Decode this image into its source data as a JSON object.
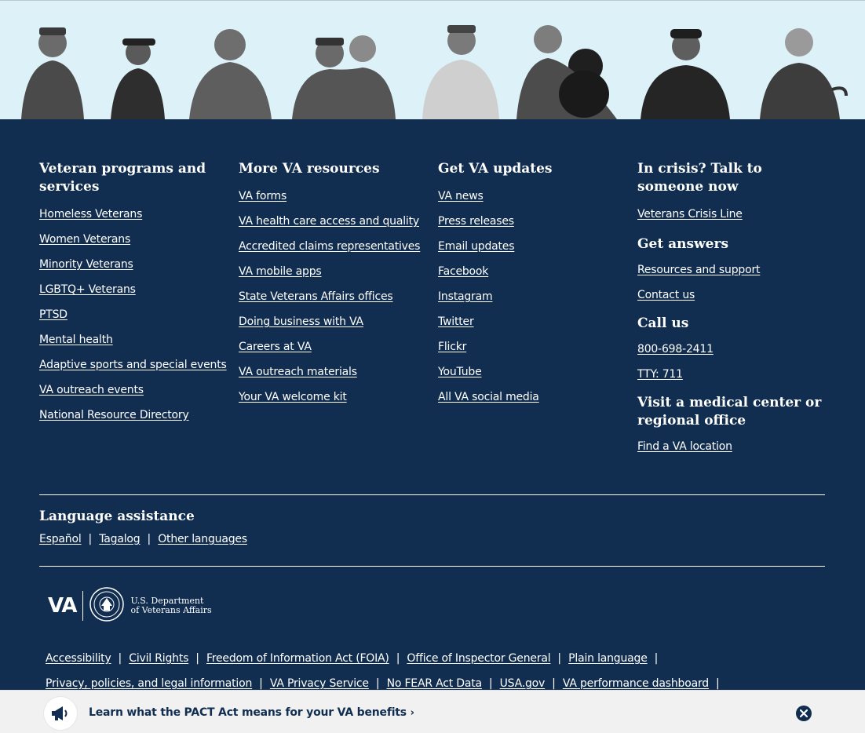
{
  "columns": [
    {
      "heading": "Veteran programs and services",
      "links": [
        "Homeless Veterans",
        "Women Veterans",
        "Minority Veterans",
        "LGBTQ+ Veterans",
        "PTSD",
        "Mental health",
        "Adaptive sports and special events",
        "VA outreach events",
        "National Resource Directory"
      ]
    },
    {
      "heading": "More VA resources",
      "links": [
        "VA forms",
        "VA health care access and quality",
        "Accredited claims representatives",
        "VA mobile apps",
        "State Veterans Affairs offices",
        "Doing business with VA",
        "Careers at VA",
        "VA outreach materials",
        "Your VA welcome kit"
      ]
    },
    {
      "heading": "Get VA updates",
      "links": [
        "VA news",
        "Press releases",
        "Email updates",
        "Facebook",
        "Instagram",
        "Twitter",
        "Flickr",
        "YouTube",
        "All VA social media"
      ]
    }
  ],
  "crisis": {
    "heading": "In crisis? Talk to someone now",
    "link": "Veterans Crisis Line"
  },
  "answers": {
    "heading": "Get answers",
    "links": [
      "Resources and support",
      "Contact us"
    ]
  },
  "call": {
    "heading": "Call us",
    "links": [
      "800-698-2411",
      "TTY: 711"
    ]
  },
  "visit": {
    "heading": "Visit a medical center or regional office",
    "link": "Find a VA location"
  },
  "language": {
    "heading": "Language assistance",
    "links": [
      "Español",
      "Tagalog",
      "Other languages"
    ]
  },
  "logo": {
    "mark": "VA",
    "dept_line1": "U.S. Department",
    "dept_line2": "of Veterans Affairs"
  },
  "legal": {
    "row1": [
      "Accessibility",
      "Civil Rights",
      "Freedom of Information Act (FOIA)",
      "Office of Inspector General",
      "Plain language"
    ],
    "row2": [
      "Privacy, policies, and legal information",
      "VA Privacy Service",
      "No FEAR Act Data",
      "USA.gov",
      "VA performance dashboard"
    ]
  },
  "banner": {
    "text": "Learn what the PACT Act means for your VA benefits",
    "icon": "megaphone-icon",
    "close_icon": "close-icon"
  },
  "colors": {
    "footer_bg": "#112e51",
    "hero_bg": "#dcf1f8",
    "banner_bg": "#f1f1f1"
  }
}
